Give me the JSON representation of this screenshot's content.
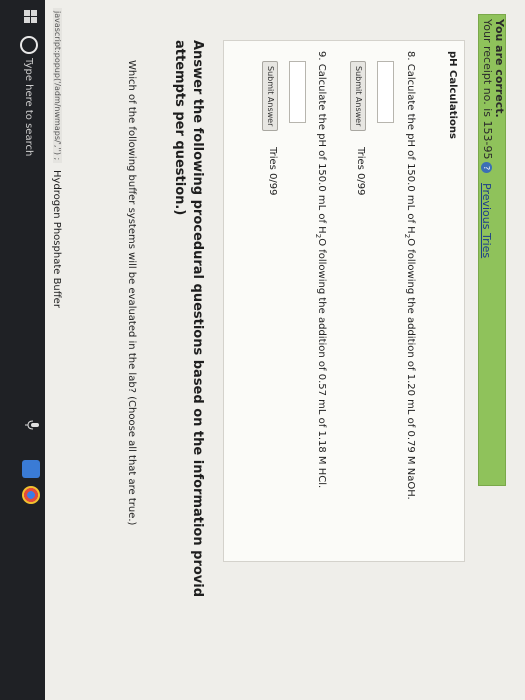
{
  "status": {
    "correct": "You are correct.",
    "receipt": "Your receipt no. is 153-95",
    "previous_tries": "Previous Tries"
  },
  "section": {
    "title": "pH Calculations"
  },
  "questions": [
    {
      "number": "8.",
      "text_before": "Calculate the pH of 150.0 mL of H",
      "sub": "2",
      "text_after": "O following the addition of 1.20 mL of 0.79 M NaOH.",
      "submit_label": "Submit Answer",
      "tries": "Tries 0/99"
    },
    {
      "number": "9.",
      "text_before": "Calculate the pH of 150.0 mL of H",
      "sub": "2",
      "text_after": "O following the addition of 0.57 mL of 1.18 M HCl.",
      "submit_label": "Submit Answer",
      "tries": "Tries 0/99"
    }
  ],
  "procedural": {
    "heading_line1": "Answer the following procedural questions based on the information provid",
    "heading_line2": "attempts per question.)",
    "question": "Which of the following buffer systems will be evaluated in the lab? (Choose all that are true.)",
    "option_1": "Hydrogen Phosphate Buffer"
  },
  "statusbar": {
    "url": "javascript:popup('/adm/nwmaps/','') ;"
  },
  "taskbar": {
    "search_placeholder": "Type here to search",
    "icons": [
      "windows-start-icon",
      "cortana-icon",
      "microphone-icon",
      "app-icon",
      "chrome-icon"
    ]
  },
  "colors": {
    "success_bg": "#8fc25b",
    "link": "#1b3e8a",
    "taskbar": "#1f2125"
  }
}
